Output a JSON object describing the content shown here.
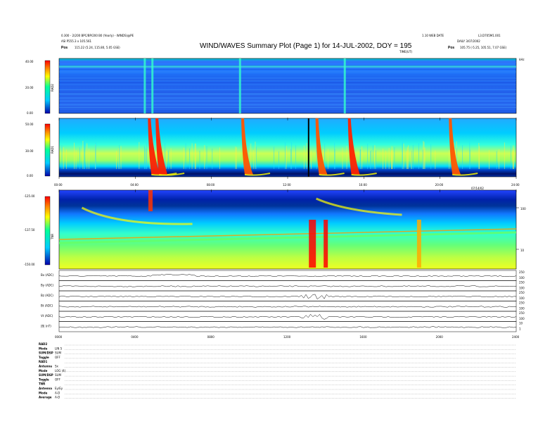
{
  "header": {
    "title": "WIND/WAVES Summary Plot (Page 1) for 14-JUL-2002, DOY = 195",
    "left_line1": "0.300 - 2(200 BPC/BP/200 B0 (Yearly) - WINDS)@PE",
    "left_line2": "ASI P555.3 x 105.561",
    "left_pos_label": "Pos",
    "left_pos_value": "115.22 (5.24, 115.80, 5.05 GSE)",
    "right_line1": "1.10 WEB DATE",
    "right_line2": "DAILY 3/07/2002",
    "right_line3": "L3.D705M1.001",
    "right_pos_label": "Pos",
    "right_pos_value": "105.75 (-5.25, 105.51, 7.07 GSE)",
    "top_axis_label": "TIME(UT)",
    "unit_label": "kHz"
  },
  "panels": [
    {
      "label": "RAD2",
      "scale_top": "40.00",
      "scale_mid": "20.00",
      "scale_bot": "0.00"
    },
    {
      "label": "RAD1",
      "scale_top": "50.00",
      "scale_mid": "30.00",
      "scale_bot": "0.00"
    },
    {
      "label": "TNR",
      "scale_top": "-125.00",
      "scale_mid": "-137.50",
      "scale_bot": "-150.00",
      "right_ticks": [
        "100",
        "10"
      ]
    }
  ],
  "time_ticks": [
    "00:00",
    "04:00",
    "08:00",
    "12:00",
    "16:00",
    "20:00",
    "24:00"
  ],
  "bottom_time_ticks": [
    "0000",
    "0400",
    "0800",
    "1200",
    "1600",
    "2000",
    "2400"
  ],
  "date_label": "07/14/02",
  "line_panels": [
    {
      "label": "Bx (ADC)",
      "right": [
        "250",
        "100"
      ]
    },
    {
      "label": "By (ADC)",
      "right": [
        "250",
        "100"
      ]
    },
    {
      "label": "Bz (ADC)",
      "right": [
        "250",
        "100"
      ]
    },
    {
      "label": "Bt (ADC)",
      "right": [
        "250",
        "100"
      ]
    },
    {
      "label": "Vt (ADC)",
      "right": [
        "250",
        "100"
      ]
    },
    {
      "label": "|B| (nT)",
      "right": [
        "10",
        "1"
      ]
    }
  ],
  "footer_rows": [
    {
      "k": "RAD2",
      "v": ""
    },
    {
      "k": "Mode",
      "v": "LIN 5"
    },
    {
      "k": "SUM/DSP",
      "v": "SUM"
    },
    {
      "k": "Toggle",
      "v": "OFF"
    },
    {
      "k": "RAD1",
      "v": ""
    },
    {
      "k": "Antenna",
      "v": "Sx"
    },
    {
      "k": "Mode",
      "v": "LOG (4)"
    },
    {
      "k": "SUM/DSP",
      "v": "SUM"
    },
    {
      "k": "Toggle",
      "v": "OFF"
    },
    {
      "k": "TNR",
      "v": ""
    },
    {
      "k": "Antenna",
      "v": "Ey/Ey"
    },
    {
      "k": "Mode",
      "v": "A-D"
    },
    {
      "k": "Average",
      "v": "A-D"
    }
  ],
  "chart_data": {
    "type": "heatmap",
    "title": "WIND/WAVES Summary Plot (Page 1) for 14-JUL-2002, DOY = 195",
    "xlabel": "TIME(UT)",
    "x_range_hours": [
      0,
      24
    ],
    "panels": [
      {
        "name": "RAD2",
        "intensity_range": [
          0,
          40
        ],
        "bursts_hours": [
          4.5,
          4.9,
          9.5,
          15.0
        ]
      },
      {
        "name": "RAD1",
        "intensity_range": [
          0,
          50
        ],
        "bursts_hours": [
          4.7,
          5.1,
          9.6,
          13.5,
          15.2,
          20.5
        ],
        "data_gap_hours": [
          13.1
        ]
      },
      {
        "name": "TNR",
        "intensity_range": [
          -150,
          -125
        ],
        "bursts_hours": [
          4.8,
          13.3,
          14.0,
          18.9
        ]
      }
    ],
    "colormap": [
      "#000080",
      "#0033ff",
      "#00ccff",
      "#33ffcc",
      "#ccff33",
      "#ffff00",
      "#ff8800",
      "#ff0000"
    ]
  }
}
